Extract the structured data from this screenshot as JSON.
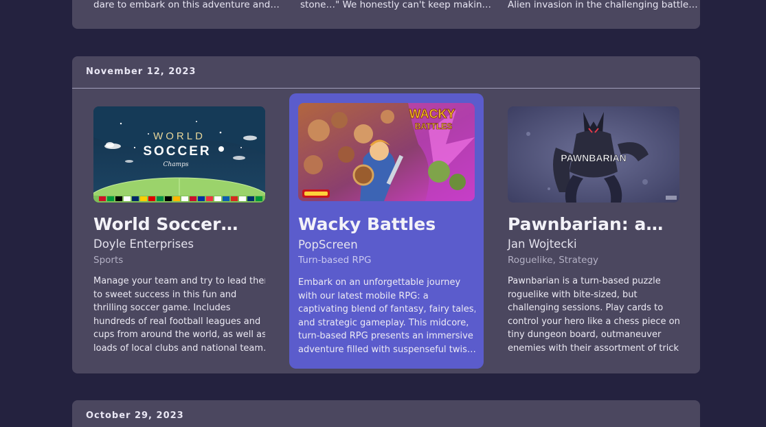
{
  "previous_section": {
    "snippets": [
      "dare to embark on this adventure and…",
      "stone…\" We honestly can't keep makin…",
      "Alien invasion in the challenging battle…"
    ]
  },
  "current_section": {
    "date": "November 12, 2023",
    "cards": [
      {
        "title": "World Soccer…",
        "developer": "Doyle Enterprises",
        "genre": "Sports",
        "image_alt": "World Soccer Champs cover art",
        "image_text": "WORLD",
        "image_text2": "SOCCER",
        "image_text3": "Champs",
        "description_lines": [
          "Manage your team and try to lead them",
          "to sweet success in this fun and",
          "thrilling soccer game. Includes",
          "hundreds of real football leagues and",
          "cups from around the world, as well as",
          "loads of local clubs and national team…"
        ]
      },
      {
        "title": "Wacky Battles",
        "developer": "PopScreen",
        "genre": "Turn-based RPG",
        "image_alt": "Wacky Battles cover art",
        "image_text": "WACKY",
        "image_text2": "BATTLES",
        "description_lines": [
          "Embark on an unforgettable journey",
          "with our latest mobile RPG: a",
          "captivating blend of fantasy, fairy tales,",
          "and strategic gameplay. This midcore,",
          "turn-based RPG presents an immersive",
          "adventure filled with suspenseful twis…"
        ]
      },
      {
        "title": "Pawnbarian: a…",
        "developer": "Jan Wojtecki",
        "genre": "Roguelike, Strategy",
        "image_alt": "Pawnbarian cover art",
        "image_text": "PAWNBARIAN",
        "description_lines": [
          "Pawnbarian is a turn-based puzzle",
          "roguelike with bite-sized, but",
          "challenging sessions. Play cards to",
          "control your hero like a chess piece on a",
          "tiny dungeon board, outmaneuver",
          "enemies with their assortment of trick…"
        ]
      }
    ]
  },
  "next_section": {
    "date": "October 29, 2023"
  },
  "colors": {
    "background": "#24223f",
    "panel": "#4b475f",
    "featured": "#5b5ccc"
  }
}
